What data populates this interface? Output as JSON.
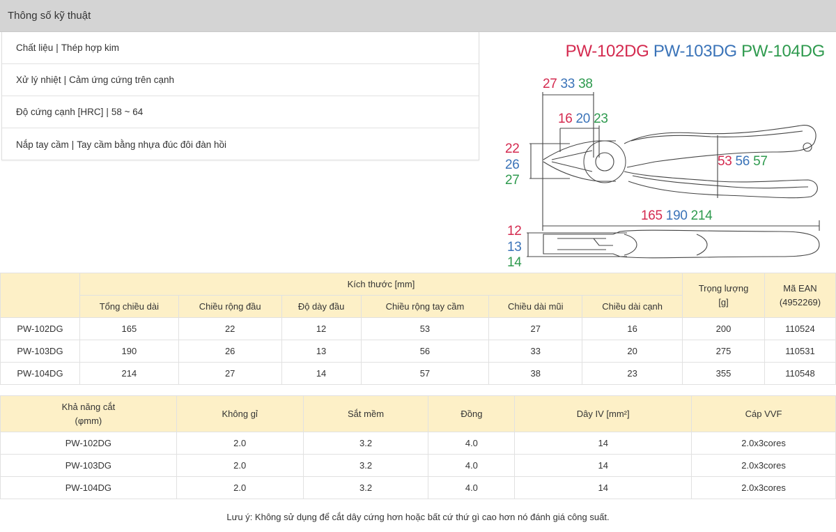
{
  "header": {
    "title": "Thông số kỹ thuật"
  },
  "specs": [
    {
      "label": "Chất liệu",
      "value": "Thép hợp kim"
    },
    {
      "label": "Xử lý nhiệt",
      "value": "Cảm ứng cứng trên cạnh"
    },
    {
      "label": "Độ cứng cạnh [HRC]",
      "value": "58 ~ 64"
    },
    {
      "label": "Nắp tay cầm",
      "value": "Tay cầm bằng nhựa đúc đôi đàn hồi"
    }
  ],
  "diagram": {
    "models": [
      "PW-102DG",
      "PW-103DG",
      "PW-104DG"
    ],
    "model_colors": [
      "#d42a4f",
      "#3a73b8",
      "#2e9a4e"
    ],
    "dims": {
      "nose_length": [
        "27",
        "33",
        "38"
      ],
      "edge_length": [
        "16",
        "20",
        "23"
      ],
      "head_width": [
        "22",
        "26",
        "27"
      ],
      "handle_width": [
        "53",
        "56",
        "57"
      ],
      "total_length": [
        "165",
        "190",
        "214"
      ],
      "head_thickness": [
        "12",
        "13",
        "14"
      ]
    }
  },
  "dimensions_table": {
    "group_header": "Kích thước [mm]",
    "weight_header": "Trọng lượng\n[g]",
    "ean_header": "Mã EAN\n(4952269)",
    "columns": [
      "Tổng chiều dài",
      "Chiều rộng đầu",
      "Độ dày đầu",
      "Chiều rộng tay cầm",
      "Chiều dài mũi",
      "Chiều dài cạnh"
    ],
    "rows": [
      {
        "model": "PW-102DG",
        "values": [
          "165",
          "22",
          "12",
          "53",
          "27",
          "16"
        ],
        "weight": "200",
        "ean": "110524"
      },
      {
        "model": "PW-103DG",
        "values": [
          "190",
          "26",
          "13",
          "56",
          "33",
          "20"
        ],
        "weight": "275",
        "ean": "110531"
      },
      {
        "model": "PW-104DG",
        "values": [
          "214",
          "27",
          "14",
          "57",
          "38",
          "23"
        ],
        "weight": "355",
        "ean": "110548"
      }
    ]
  },
  "cutting_table": {
    "headers": [
      "Khả năng cắt\n(φmm)",
      "Không gỉ",
      "Sắt mềm",
      "Đồng",
      "Dây IV [mm²]",
      "Cáp VVF"
    ],
    "rows": [
      {
        "model": "PW-102DG",
        "values": [
          "2.0",
          "3.2",
          "4.0",
          "14",
          "2.0x3cores"
        ]
      },
      {
        "model": "PW-103DG",
        "values": [
          "2.0",
          "3.2",
          "4.0",
          "14",
          "2.0x3cores"
        ]
      },
      {
        "model": "PW-104DG",
        "values": [
          "2.0",
          "3.2",
          "4.0",
          "14",
          "2.0x3cores"
        ]
      }
    ]
  },
  "note": "Lưu ý: Không sử dụng để cắt dây cứng hơn hoặc bất cứ thứ gì cao hơn nó đánh giá công suất."
}
